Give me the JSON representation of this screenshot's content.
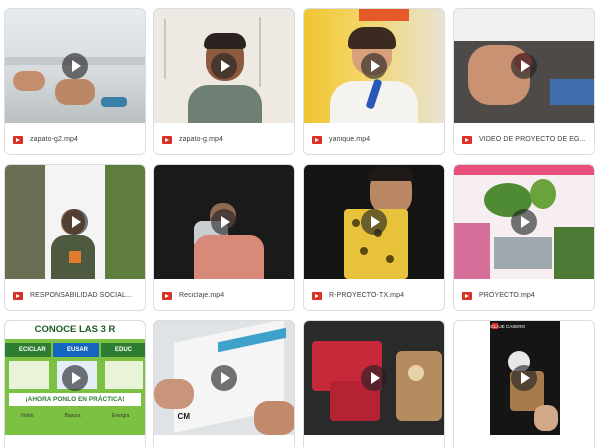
{
  "videos": [
    {
      "name": "zapato-g2.mp4"
    },
    {
      "name": "zapato-g.mp4"
    },
    {
      "name": "yanique.mp4"
    },
    {
      "name": "VIDEO DE PROYECTO DE EG..."
    },
    {
      "name": "RESPONSABILIDAD SOCIAL..."
    },
    {
      "name": "Reciclaje.mp4"
    },
    {
      "name": "R-PROYECTO-TX.mp4"
    },
    {
      "name": "PROYECTO.mp4"
    },
    {
      "name": "",
      "thumb_text": {
        "title": "CONOCE LAS 3 R",
        "col1": "ECICLAR",
        "col2": "EUSAR",
        "col3": "EDUC",
        "bottom": "¡AHORA PONLO EN PRÁCTICA!",
        "labels": [
          "Vidrio",
          "Basura",
          "Energía"
        ]
      }
    },
    {
      "name": "",
      "thumb_text": {
        "cm": "CM"
      }
    },
    {
      "name": ""
    },
    {
      "name": "",
      "thumb_text": {
        "head": "RECICLAJE CASERO"
      }
    }
  ],
  "colors": {
    "file_icon": "#d93025",
    "card_border": "#dadce0",
    "text": "#3c4043"
  },
  "icons": {
    "play": "play-icon",
    "file": "video-file-icon"
  }
}
